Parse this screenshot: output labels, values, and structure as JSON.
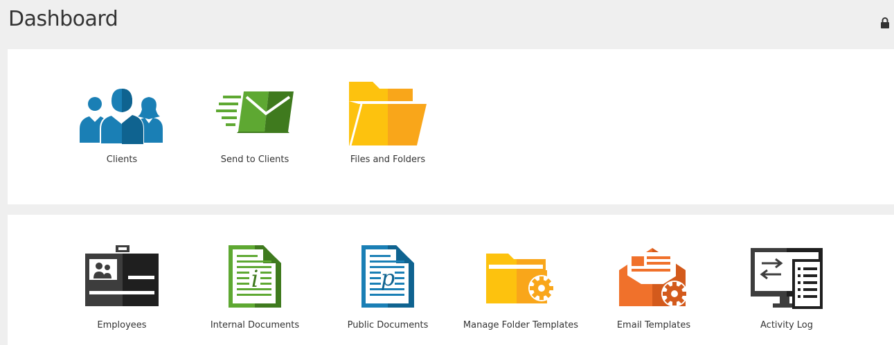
{
  "header": {
    "title": "Dashboard",
    "lock_icon": "lock-icon"
  },
  "colors": {
    "blue": "#1a7fb5",
    "blue_dark": "#0f6390",
    "green": "#5ea832",
    "green_dark": "#3f7a1e",
    "yellow": "#fdc20e",
    "orange_yellow": "#f9a61a",
    "orange": "#f0712b",
    "orange_dark": "#d35a1c",
    "charcoal": "#3d3d3d",
    "black": "#1f1f1f"
  },
  "panel1": {
    "tiles": [
      {
        "label": "Clients",
        "icon": "clients-icon"
      },
      {
        "label": "Send to Clients",
        "icon": "send-to-clients-icon"
      },
      {
        "label": "Files and Folders",
        "icon": "folder-icon"
      }
    ]
  },
  "panel2": {
    "tiles": [
      {
        "label": "Employees",
        "icon": "employee-badge-icon"
      },
      {
        "label": "Internal Documents",
        "icon": "internal-document-icon"
      },
      {
        "label": "Public Documents",
        "icon": "public-document-icon"
      },
      {
        "label": "Manage Folder Templates",
        "icon": "folder-gear-icon"
      },
      {
        "label": "Email Templates",
        "icon": "email-gear-icon"
      },
      {
        "label": "Activity Log",
        "icon": "activity-monitor-icon"
      }
    ]
  }
}
